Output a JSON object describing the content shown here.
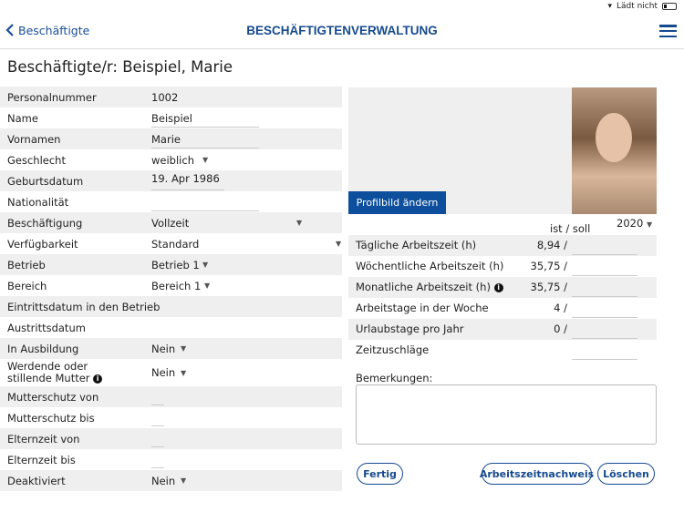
{
  "status": {
    "charging": "Lädt nicht"
  },
  "nav": {
    "back_label": "Beschäftigte",
    "title": "BESCHÄFTIGTENVERWALTUNG"
  },
  "page": {
    "heading": "Beschäftigte/r: Beispiel, Marie"
  },
  "fields": [
    {
      "label": "Personalnummer",
      "value": "1002"
    },
    {
      "label": "Name",
      "value": "Beispiel"
    },
    {
      "label": "Vornamen",
      "value": "Marie"
    },
    {
      "label": "Geschlecht",
      "value": "weiblich"
    },
    {
      "label": "Geburtsdatum",
      "value": "19. Apr 1986"
    },
    {
      "label": "Nationalität",
      "value": ""
    },
    {
      "label": "Beschäftigung",
      "value": "Vollzeit"
    },
    {
      "label": "Verfügbarkeit",
      "value": "Standard"
    },
    {
      "label": "Betrieb",
      "value": "Betrieb 1"
    },
    {
      "label": "Bereich",
      "value": "Bereich 1"
    },
    {
      "label": "Eintrittsdatum in den Betrieb",
      "value": ""
    },
    {
      "label": "Austrittsdatum",
      "value": ""
    },
    {
      "label": "In Ausbildung",
      "value": "Nein"
    },
    {
      "label": "Werdende oder stillende Mutter",
      "value": "Nein"
    },
    {
      "label": "Mutterschutz von",
      "value": ""
    },
    {
      "label": "Mutterschutz bis",
      "value": ""
    },
    {
      "label": "Elternzeit von",
      "value": ""
    },
    {
      "label": "Elternzeit bis",
      "value": ""
    },
    {
      "label": "Deaktiviert",
      "value": "Nein"
    }
  ],
  "profile": {
    "change_button": "Profilbild ändern"
  },
  "worktime": {
    "header": "ist / soll",
    "year": "2020",
    "rows": [
      {
        "label": "Tägliche Arbeitszeit (h)",
        "ist": "8,94 /"
      },
      {
        "label": "Wöchentliche Arbeitszeit (h)",
        "ist": "35,75 /"
      },
      {
        "label": "Monatliche Arbeitszeit (h)",
        "ist": "35,75 /"
      },
      {
        "label": "Arbeitstage in der Woche",
        "ist": "4 /"
      },
      {
        "label": "Urlaubstage pro Jahr",
        "ist": "0 /"
      },
      {
        "label": "Zeitzuschläge",
        "ist": ""
      }
    ]
  },
  "remarks": {
    "label": "Bemerkungen:",
    "value": ""
  },
  "buttons": {
    "done": "Fertig",
    "proof": "Arbeitszeitnachweis",
    "delete": "Löschen"
  },
  "colors": {
    "brand": "#164a8e",
    "button": "#0d4f9c"
  }
}
